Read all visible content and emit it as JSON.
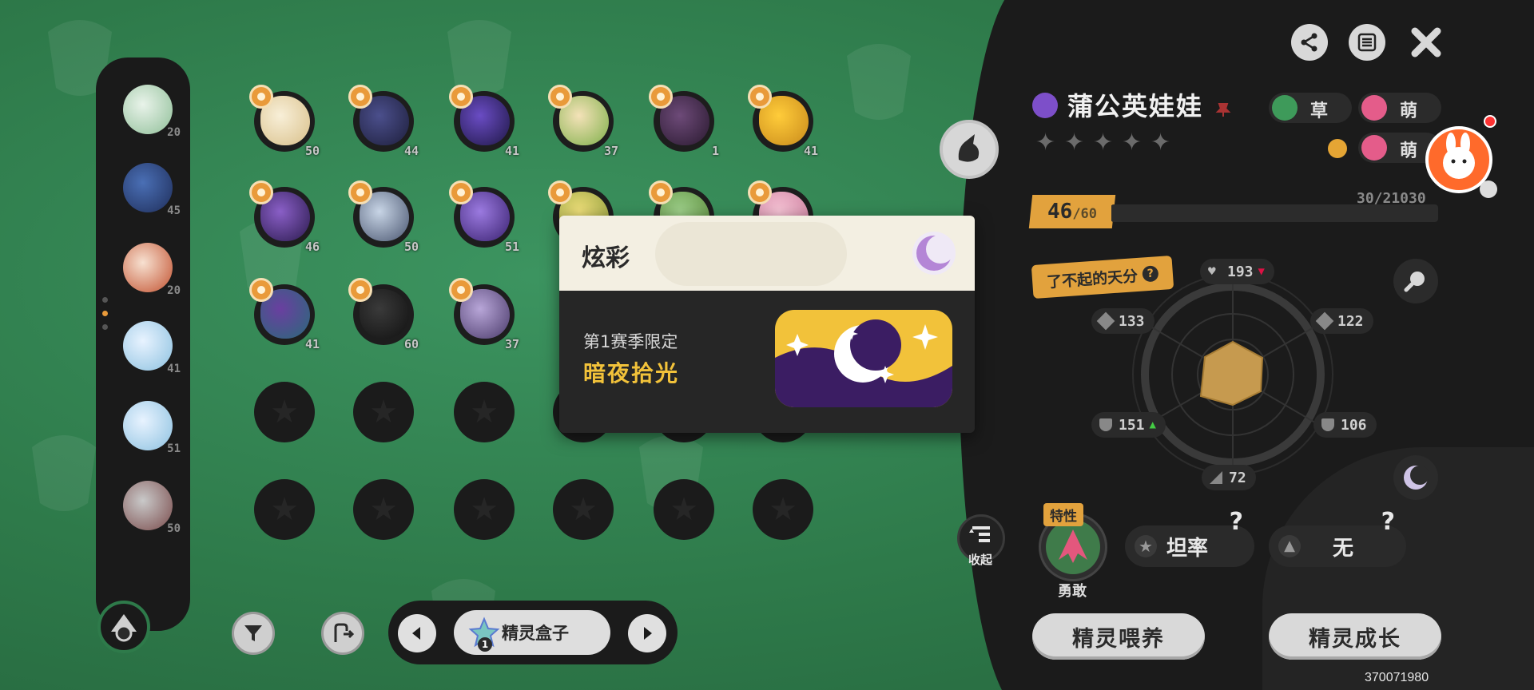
{
  "team": {
    "levels": [
      "20",
      "45",
      "20",
      "41",
      "51",
      "50"
    ]
  },
  "grid": {
    "rows": [
      [
        {
          "level": "50"
        },
        {
          "level": "44"
        },
        {
          "level": "41"
        },
        {
          "level": "37"
        },
        {
          "level": "1"
        },
        {
          "level": "41"
        }
      ],
      [
        {
          "level": "46"
        },
        {
          "level": "50"
        },
        {
          "level": "51"
        },
        {
          "level": ""
        },
        {
          "level": ""
        },
        {
          "level": ""
        }
      ],
      [
        {
          "level": "41"
        },
        {
          "level": "60"
        },
        {
          "level": "37"
        }
      ]
    ]
  },
  "bottom_bar": {
    "box_label": "精灵盒子",
    "box_badge": "1"
  },
  "popup": {
    "title": "炫彩",
    "subtitle": "第1赛季限定",
    "skin_name": "暗夜拾光"
  },
  "pet": {
    "name": "蒲公英娃娃",
    "types": [
      "草",
      "萌",
      "萌"
    ],
    "level": "46",
    "level_max": "/60",
    "exp": "30/21030",
    "talent_label": "了不起的天分",
    "stats": {
      "hp": "193",
      "attack": "133",
      "sp_attack": "122",
      "defense": "151",
      "sp_defense": "106",
      "speed": "72"
    },
    "trait_tag": "特性",
    "nature": "勇敢",
    "ability1": "坦率",
    "ability2": "无",
    "collapse_label": "收起"
  },
  "actions": {
    "feed": "精灵喂养",
    "grow": "精灵成长"
  },
  "uid": "370071980",
  "colors": {
    "accent": "#e2a23d",
    "panel": "#1b1b1b",
    "background": "#2e7a4a",
    "shiny_gold": "#f2c23a",
    "shiny_purple": "#3b1d63"
  }
}
